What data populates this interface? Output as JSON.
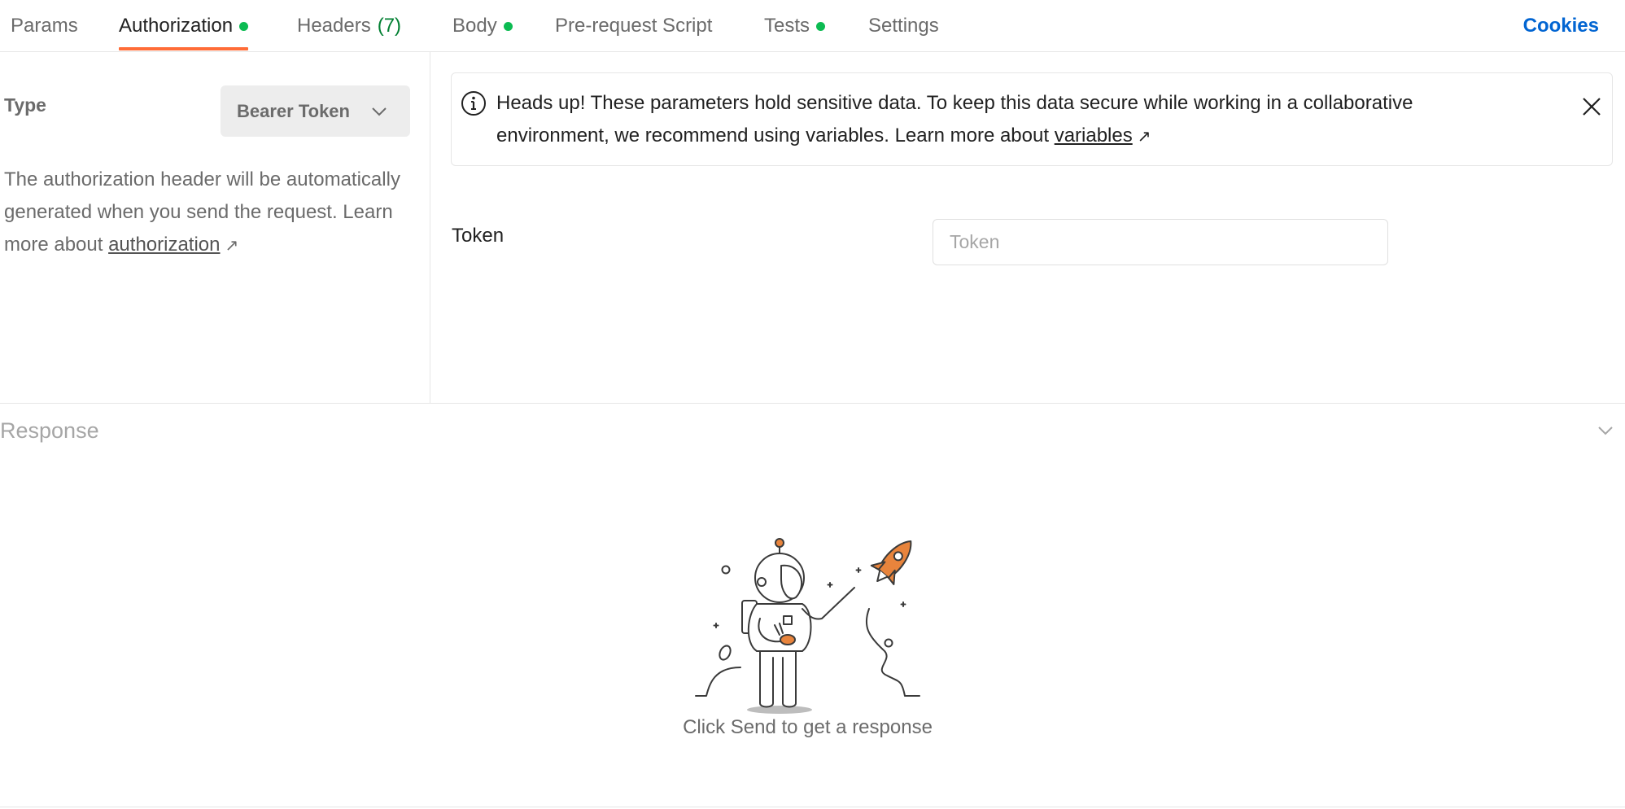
{
  "tabs": {
    "params": "Params",
    "authorization": "Authorization",
    "headers": "Headers",
    "headers_count": "(7)",
    "body": "Body",
    "prerequest": "Pre-request Script",
    "tests": "Tests",
    "settings": "Settings",
    "active": "Authorization",
    "dot_color": "#0cbb52",
    "active_underline_color": "#ff6c37"
  },
  "cookies_label": "Cookies",
  "auth": {
    "type_label": "Type",
    "type_value": "Bearer Token",
    "description": "The authorization header will be automatically generated when you send the request. Learn more about ",
    "link_text": "authorization",
    "link_arrow": "↗"
  },
  "notice": {
    "text": "Heads up! These parameters hold sensitive data. To keep this data secure while working in a collaborative environment, we recommend using variables. Learn more about ",
    "link_text": "variables",
    "link_arrow": "↗"
  },
  "token": {
    "label": "Token",
    "placeholder": "Token",
    "value": ""
  },
  "response": {
    "title": "Response",
    "empty_message": "Click Send to get a response"
  },
  "icons": {
    "info": "info-icon",
    "close": "close-icon",
    "chevron": "chevron-down-icon",
    "illustration": "astronaut-rocket-illustration"
  }
}
